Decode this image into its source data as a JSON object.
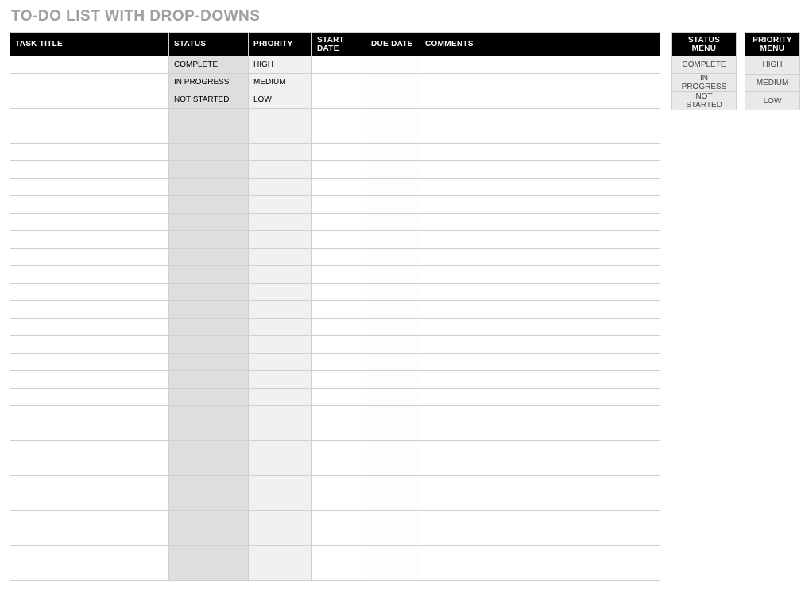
{
  "title": "TO-DO LIST WITH DROP-DOWNS",
  "main": {
    "columns": {
      "task_title": "TASK TITLE",
      "status": "STATUS",
      "priority": "PRIORITY",
      "start_date": "START DATE",
      "due_date": "DUE DATE",
      "comments": "COMMENTS"
    },
    "rows": [
      {
        "task_title": "",
        "status": "COMPLETE",
        "priority": "HIGH",
        "start_date": "",
        "due_date": "",
        "comments": ""
      },
      {
        "task_title": "",
        "status": "IN PROGRESS",
        "priority": "MEDIUM",
        "start_date": "",
        "due_date": "",
        "comments": ""
      },
      {
        "task_title": "",
        "status": "NOT STARTED",
        "priority": "LOW",
        "start_date": "",
        "due_date": "",
        "comments": ""
      },
      {
        "task_title": "",
        "status": "",
        "priority": "",
        "start_date": "",
        "due_date": "",
        "comments": ""
      },
      {
        "task_title": "",
        "status": "",
        "priority": "",
        "start_date": "",
        "due_date": "",
        "comments": ""
      },
      {
        "task_title": "",
        "status": "",
        "priority": "",
        "start_date": "",
        "due_date": "",
        "comments": ""
      },
      {
        "task_title": "",
        "status": "",
        "priority": "",
        "start_date": "",
        "due_date": "",
        "comments": ""
      },
      {
        "task_title": "",
        "status": "",
        "priority": "",
        "start_date": "",
        "due_date": "",
        "comments": ""
      },
      {
        "task_title": "",
        "status": "",
        "priority": "",
        "start_date": "",
        "due_date": "",
        "comments": ""
      },
      {
        "task_title": "",
        "status": "",
        "priority": "",
        "start_date": "",
        "due_date": "",
        "comments": ""
      },
      {
        "task_title": "",
        "status": "",
        "priority": "",
        "start_date": "",
        "due_date": "",
        "comments": ""
      },
      {
        "task_title": "",
        "status": "",
        "priority": "",
        "start_date": "",
        "due_date": "",
        "comments": ""
      },
      {
        "task_title": "",
        "status": "",
        "priority": "",
        "start_date": "",
        "due_date": "",
        "comments": ""
      },
      {
        "task_title": "",
        "status": "",
        "priority": "",
        "start_date": "",
        "due_date": "",
        "comments": ""
      },
      {
        "task_title": "",
        "status": "",
        "priority": "",
        "start_date": "",
        "due_date": "",
        "comments": ""
      },
      {
        "task_title": "",
        "status": "",
        "priority": "",
        "start_date": "",
        "due_date": "",
        "comments": ""
      },
      {
        "task_title": "",
        "status": "",
        "priority": "",
        "start_date": "",
        "due_date": "",
        "comments": ""
      },
      {
        "task_title": "",
        "status": "",
        "priority": "",
        "start_date": "",
        "due_date": "",
        "comments": ""
      },
      {
        "task_title": "",
        "status": "",
        "priority": "",
        "start_date": "",
        "due_date": "",
        "comments": ""
      },
      {
        "task_title": "",
        "status": "",
        "priority": "",
        "start_date": "",
        "due_date": "",
        "comments": ""
      },
      {
        "task_title": "",
        "status": "",
        "priority": "",
        "start_date": "",
        "due_date": "",
        "comments": ""
      },
      {
        "task_title": "",
        "status": "",
        "priority": "",
        "start_date": "",
        "due_date": "",
        "comments": ""
      },
      {
        "task_title": "",
        "status": "",
        "priority": "",
        "start_date": "",
        "due_date": "",
        "comments": ""
      },
      {
        "task_title": "",
        "status": "",
        "priority": "",
        "start_date": "",
        "due_date": "",
        "comments": ""
      },
      {
        "task_title": "",
        "status": "",
        "priority": "",
        "start_date": "",
        "due_date": "",
        "comments": ""
      },
      {
        "task_title": "",
        "status": "",
        "priority": "",
        "start_date": "",
        "due_date": "",
        "comments": ""
      },
      {
        "task_title": "",
        "status": "",
        "priority": "",
        "start_date": "",
        "due_date": "",
        "comments": ""
      },
      {
        "task_title": "",
        "status": "",
        "priority": "",
        "start_date": "",
        "due_date": "",
        "comments": ""
      },
      {
        "task_title": "",
        "status": "",
        "priority": "",
        "start_date": "",
        "due_date": "",
        "comments": ""
      },
      {
        "task_title": "",
        "status": "",
        "priority": "",
        "start_date": "",
        "due_date": "",
        "comments": ""
      }
    ]
  },
  "status_menu": {
    "header": "STATUS MENU",
    "options": [
      "COMPLETE",
      "IN PROGRESS",
      "NOT STARTED"
    ]
  },
  "priority_menu": {
    "header": "PRIORITY MENU",
    "options": [
      "HIGH",
      "MEDIUM",
      "LOW"
    ]
  }
}
